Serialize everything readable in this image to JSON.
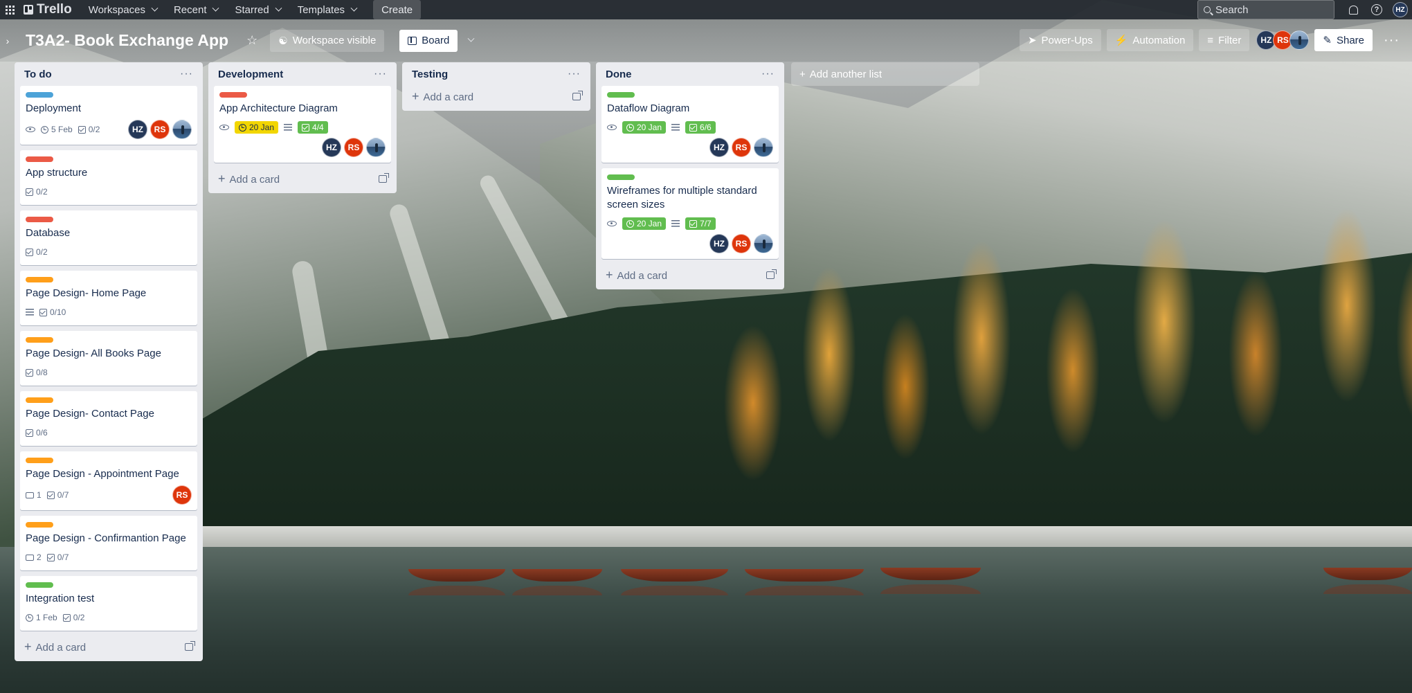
{
  "nav": {
    "brand": "Trello",
    "menus": [
      "Workspaces",
      "Recent",
      "Starred",
      "Templates"
    ],
    "create_label": "Create",
    "search_placeholder": "Search",
    "user_initials": "HZ"
  },
  "board": {
    "title": "T3A2- Book Exchange App",
    "visibility_label": "Workspace visible",
    "view_label": "Board",
    "powerups_label": "Power-Ups",
    "automation_label": "Automation",
    "filter_label": "Filter",
    "share_label": "Share",
    "add_list_label": "Add another list",
    "add_card_label": "Add a card",
    "members": [
      "HZ",
      "RS",
      "photo"
    ]
  },
  "colors": {
    "label_blue": "#4da3d8",
    "label_red": "#eb5a46",
    "label_orange": "#ff9f1a",
    "label_green": "#61bd4f",
    "due_yellow": "#f2d600",
    "avatar_hz": "#253858",
    "avatar_rs": "#de350b"
  },
  "lists": [
    {
      "title": "To do",
      "cards": [
        {
          "label": "blue",
          "title": "Deployment",
          "watch": true,
          "due": "5 Feb",
          "checklist": "0/2",
          "members": [
            "HZ",
            "RS",
            "photo"
          ]
        },
        {
          "label": "red",
          "title": "App structure",
          "checklist": "0/2"
        },
        {
          "label": "red",
          "title": "Database",
          "checklist": "0/2"
        },
        {
          "label": "orange",
          "title": "Page Design- Home Page",
          "description": true,
          "checklist": "0/10"
        },
        {
          "label": "orange",
          "title": "Page Design- All Books Page",
          "checklist": "0/8"
        },
        {
          "label": "orange",
          "title": "Page Design- Contact Page",
          "checklist": "0/6"
        },
        {
          "label": "orange",
          "title": "Page Design - Appointment Page",
          "comments": "1",
          "checklist": "0/7",
          "members": [
            "RS"
          ]
        },
        {
          "label": "orange",
          "title": "Page Design - Confirmantion Page",
          "comments": "2",
          "checklist": "0/7"
        },
        {
          "label": "green",
          "title": "Integration test",
          "due": "1 Feb",
          "checklist": "0/2"
        }
      ]
    },
    {
      "title": "Development",
      "cards": [
        {
          "label": "red",
          "title": "App Architecture Diagram",
          "watch": true,
          "due": "20 Jan",
          "due_style": "yellow",
          "description": true,
          "checklist": "4/4",
          "checklist_done": true,
          "members": [
            "HZ",
            "RS",
            "photo"
          ]
        }
      ]
    },
    {
      "title": "Testing",
      "cards": []
    },
    {
      "title": "Done",
      "cards": [
        {
          "label": "green",
          "title": "Dataflow Diagram",
          "watch": true,
          "due": "20 Jan",
          "due_style": "green",
          "description": true,
          "checklist": "6/6",
          "checklist_done": true,
          "members": [
            "HZ",
            "RS",
            "photo"
          ]
        },
        {
          "label": "green",
          "title": "Wireframes for multiple standard screen sizes",
          "watch": true,
          "due": "20 Jan",
          "due_style": "green",
          "description": true,
          "checklist": "7/7",
          "checklist_done": true,
          "members": [
            "HZ",
            "RS",
            "photo"
          ]
        }
      ]
    }
  ]
}
